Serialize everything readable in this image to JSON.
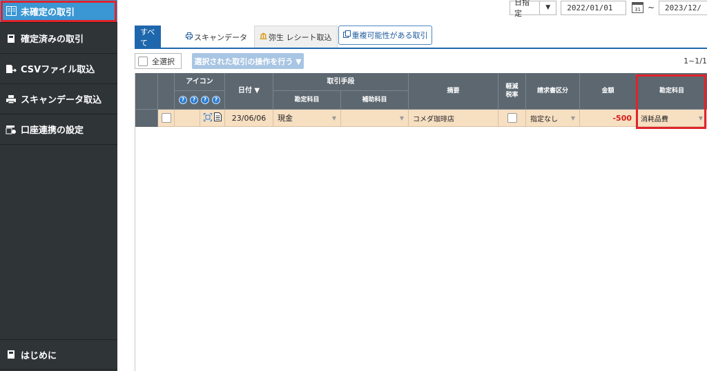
{
  "sidebar": {
    "items": [
      {
        "label": "未確定の取引",
        "icon": "book-icon"
      },
      {
        "label": "確定済みの取引",
        "icon": "document-icon"
      },
      {
        "label": "CSVファイル取込",
        "icon": "csv-import-icon"
      },
      {
        "label": "スキャンデータ取込",
        "icon": "scanner-icon"
      },
      {
        "label": "口座連携の設定",
        "icon": "bank-settings-icon"
      }
    ],
    "bottom_item": {
      "label": "はじめに",
      "icon": "document-icon"
    }
  },
  "date_filter": {
    "mode": "日指定",
    "start": "2022/01/01",
    "separator": "~",
    "end": "2023/12/",
    "calendar_day": "31"
  },
  "tabs": [
    {
      "label": "すべて",
      "icon": ""
    },
    {
      "label": "スキャンデータ",
      "icon": "printer-icon"
    },
    {
      "label": "弥生 レシート取込",
      "icon": "bank-icon"
    }
  ],
  "duplicate_button": "重複可能性がある取引",
  "actions": {
    "select_all": "全選択",
    "bulk_operation": "選択された取引の操作を行う ▼"
  },
  "pagination": "1~1/1",
  "table": {
    "headers": {
      "icon": "アイコン",
      "help": [
        "?",
        "?",
        "?",
        "?"
      ],
      "date": "日付 ▼",
      "method": "取引手段",
      "account": "勘定科目",
      "sub_account": "補助科目",
      "summary": "摘要",
      "reduced_tax": "軽減\n税率",
      "invoice_type": "請求書区分",
      "amount": "金額",
      "category": "勘定科目"
    },
    "rows": [
      {
        "date": "23/06/06",
        "account": "現金",
        "sub_account": "",
        "summary": "コメダ珈琲店",
        "invoice_type": "指定なし",
        "amount": "-500",
        "category": "消耗品費"
      }
    ]
  },
  "colors": {
    "sidebar_bg": "#2f3437",
    "active_item": "#3a97d3",
    "tab_active": "#1f67ad",
    "header_bg": "#5c6770",
    "row_bg": "#f7dfc2",
    "negative_amount": "#d3201a",
    "highlight_outline": "#e0232a"
  }
}
